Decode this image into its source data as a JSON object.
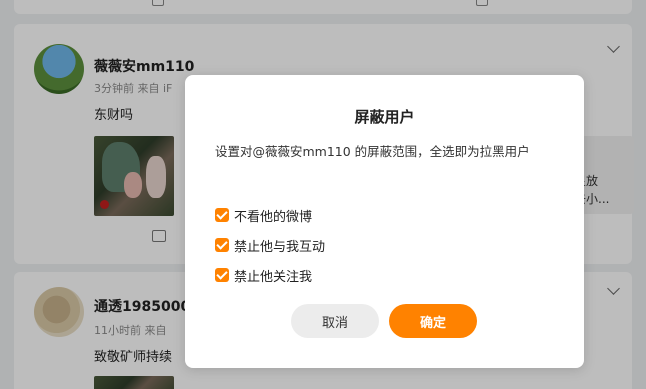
{
  "feed": {
    "posts": [
      {
        "username": "薇薇安mm110",
        "meta": "3分钟前  来自 iF",
        "text": "东财吗",
        "side_lines": [
          "星放",
          "去小..."
        ]
      },
      {
        "username": "通透1985000",
        "meta": "11小时前  来自",
        "text": "致敬矿师持续"
      }
    ]
  },
  "dialog": {
    "title": "屏蔽用户",
    "description": "设置对@薇薇安mm110 的屏蔽范围，全选即为拉黑用户",
    "options": [
      {
        "label": "不看他的微博",
        "checked": true
      },
      {
        "label": "禁止他与我互动",
        "checked": true
      },
      {
        "label": "禁止他关注我",
        "checked": true
      }
    ],
    "cancel_label": "取消",
    "confirm_label": "确定"
  },
  "colors": {
    "accent": "#ff8200",
    "cancel_bg": "#ececec"
  }
}
